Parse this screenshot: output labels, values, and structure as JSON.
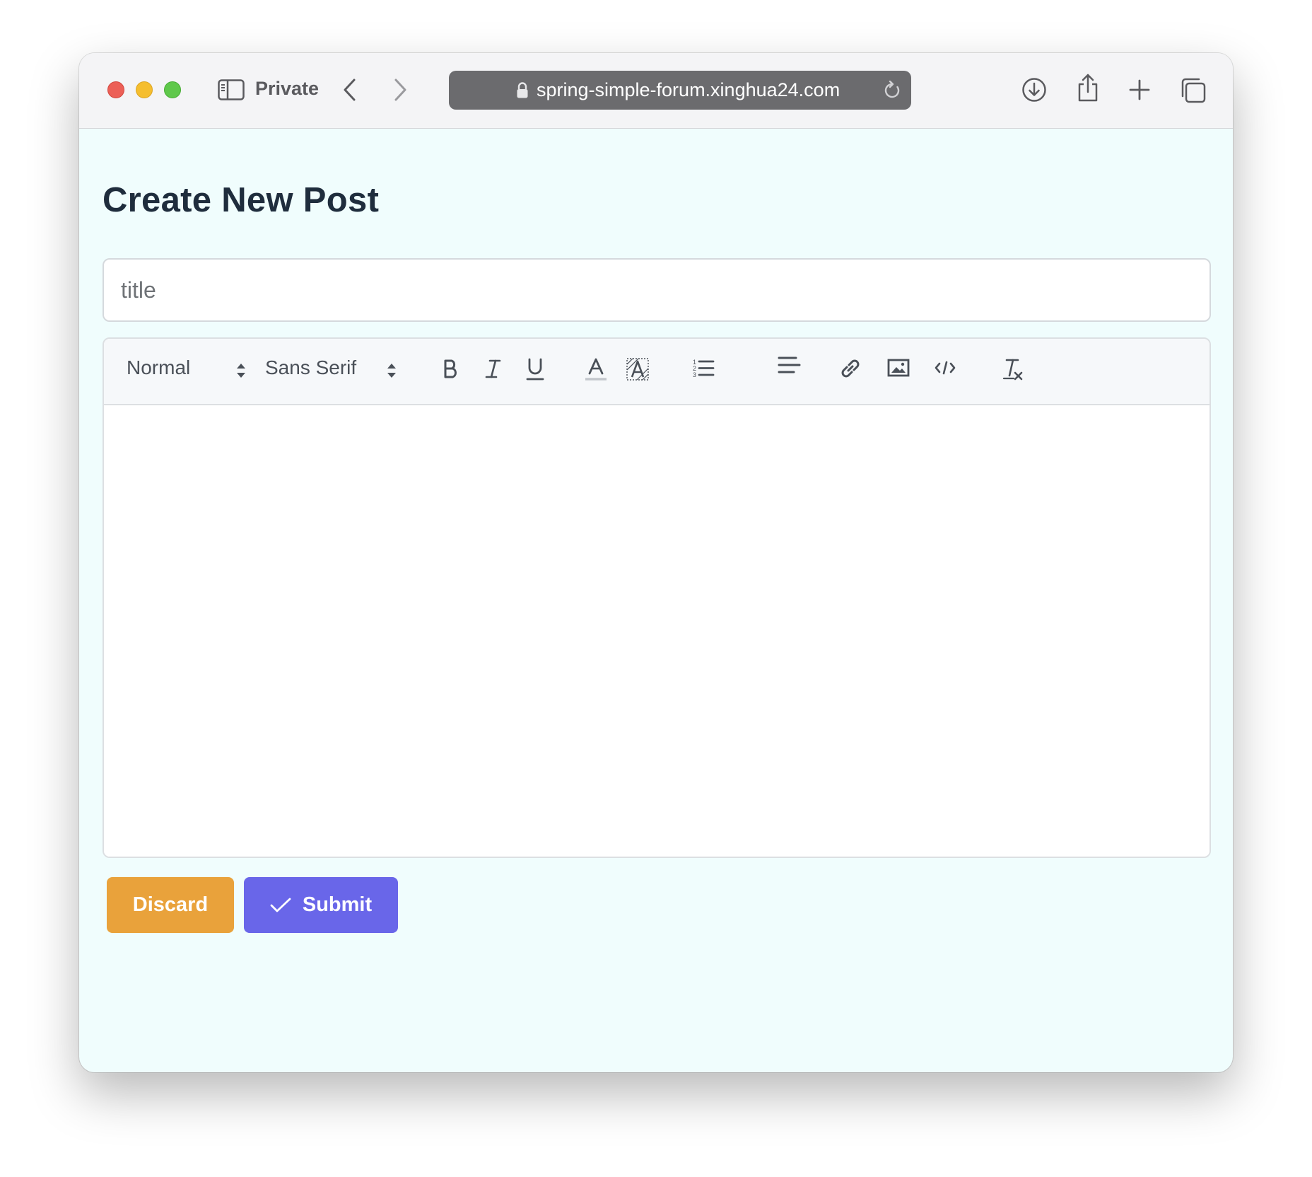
{
  "browser": {
    "private_label": "Private",
    "url": "spring-simple-forum.xinghua24.com"
  },
  "page": {
    "title": "Create New Post"
  },
  "form": {
    "title_placeholder": "title",
    "title_value": ""
  },
  "editor": {
    "size_select": "Normal",
    "font_select": "Sans Serif",
    "content": ""
  },
  "actions": {
    "discard_label": "Discard",
    "submit_label": "Submit"
  },
  "colors": {
    "discard": "#e9a23b",
    "submit": "#6966e9",
    "page_background": "#f0fdfd",
    "heading": "#1f2d3d"
  }
}
